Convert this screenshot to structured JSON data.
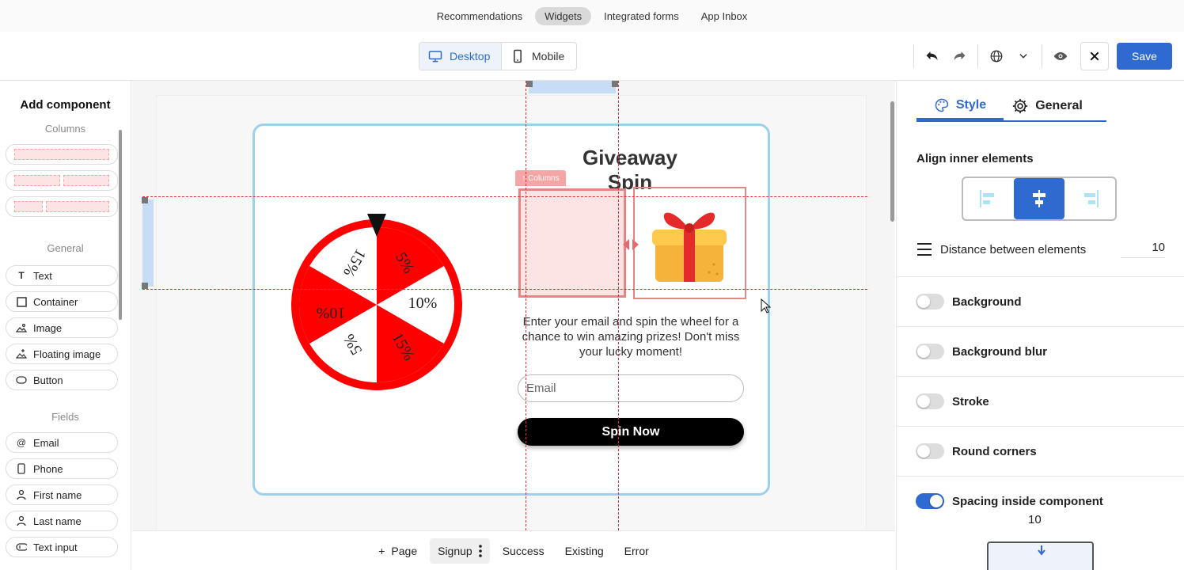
{
  "topnav": {
    "items": [
      {
        "label": "Recommendations",
        "active": false
      },
      {
        "label": "Widgets",
        "active": true
      },
      {
        "label": "Integrated forms",
        "active": false
      },
      {
        "label": "App Inbox",
        "active": false
      }
    ]
  },
  "toolbar": {
    "desktop_label": "Desktop",
    "mobile_label": "Mobile",
    "save_label": "Save"
  },
  "left": {
    "title": "Add component",
    "columns_section": "Columns",
    "general_section": "General",
    "general_items": [
      "Text",
      "Container",
      "Image",
      "Floating image",
      "Button"
    ],
    "fields_section": "Fields",
    "field_items": [
      "Email",
      "Phone",
      "First name",
      "Last name",
      "Text input"
    ]
  },
  "canvas": {
    "title": "Giveaway Spin",
    "description": "Enter your email and spin the wheel for a chance to win amazing prizes! Don't miss your lucky moment!",
    "email_placeholder": "Email",
    "button_label": "Spin Now",
    "column_tag": "Columns",
    "wheel_labels": [
      "5%",
      "10%",
      "15%",
      "5%",
      "10%",
      "15%"
    ],
    "colors": {
      "wheel_red": "#ff0000",
      "accent": "#2f6ad0"
    }
  },
  "pagebar": {
    "add_label": "Page",
    "tabs": [
      "Signup",
      "Success",
      "Existing",
      "Error"
    ]
  },
  "right": {
    "tab_style": "Style",
    "tab_general": "General",
    "align_label": "Align inner elements",
    "distance_label": "Distance between elements",
    "distance_value": "10",
    "toggles": [
      {
        "label": "Background",
        "on": false
      },
      {
        "label": "Background blur",
        "on": false
      },
      {
        "label": "Stroke",
        "on": false
      },
      {
        "label": "Round corners",
        "on": false
      },
      {
        "label": "Spacing inside component",
        "on": true
      }
    ],
    "spacing_value": "10"
  }
}
